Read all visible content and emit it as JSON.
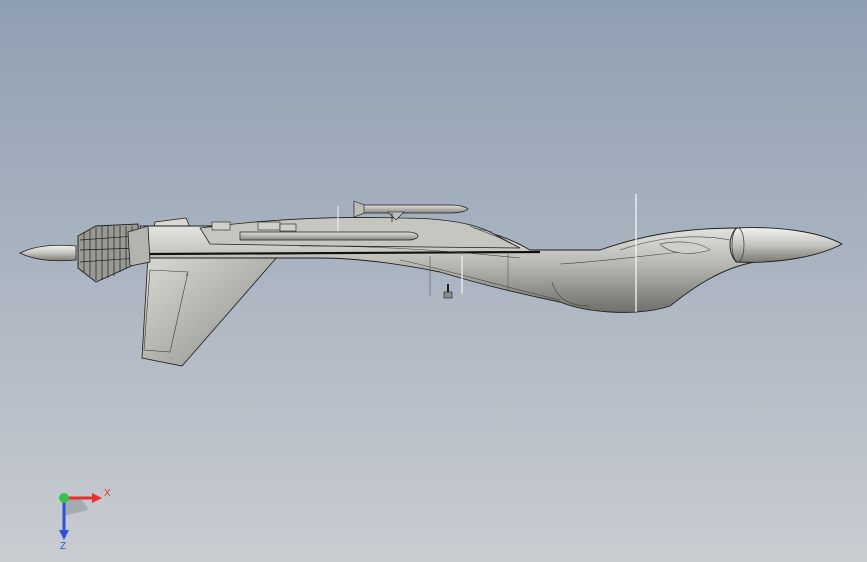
{
  "viewport": {
    "background_top": "#8f9fb2",
    "background_bottom": "#c9ccd1"
  },
  "model": {
    "fill_light": "#c8c8c4",
    "fill_dark": "#7d7d78",
    "edge_color": "#1e1e1e",
    "highlight": "#f4f4f0"
  },
  "triad": {
    "x_label": "X",
    "z_label": "Z",
    "x_color": "#e8302b",
    "y_color": "#39c24a",
    "z_color": "#2f4fd8"
  }
}
